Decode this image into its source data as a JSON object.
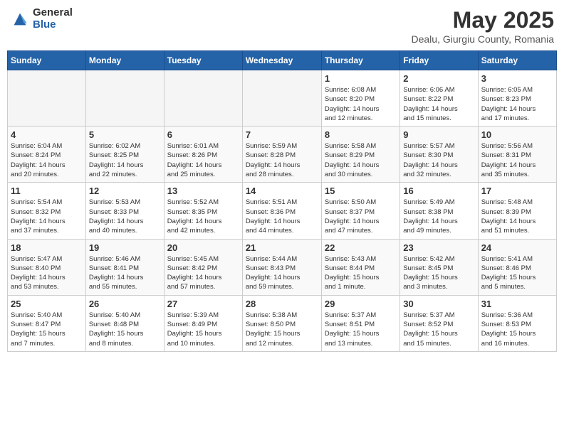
{
  "header": {
    "logo": {
      "general": "General",
      "blue": "Blue"
    },
    "title": "May 2025",
    "subtitle": "Dealu, Giurgiu County, Romania"
  },
  "calendar": {
    "days_of_week": [
      "Sunday",
      "Monday",
      "Tuesday",
      "Wednesday",
      "Thursday",
      "Friday",
      "Saturday"
    ],
    "weeks": [
      {
        "row_class": "row-odd",
        "days": [
          {
            "num": "",
            "info": "",
            "empty": true
          },
          {
            "num": "",
            "info": "",
            "empty": true
          },
          {
            "num": "",
            "info": "",
            "empty": true
          },
          {
            "num": "",
            "info": "",
            "empty": true
          },
          {
            "num": "1",
            "info": "Sunrise: 6:08 AM\nSunset: 8:20 PM\nDaylight: 14 hours\nand 12 minutes.",
            "empty": false
          },
          {
            "num": "2",
            "info": "Sunrise: 6:06 AM\nSunset: 8:22 PM\nDaylight: 14 hours\nand 15 minutes.",
            "empty": false
          },
          {
            "num": "3",
            "info": "Sunrise: 6:05 AM\nSunset: 8:23 PM\nDaylight: 14 hours\nand 17 minutes.",
            "empty": false
          }
        ]
      },
      {
        "row_class": "row-even",
        "days": [
          {
            "num": "4",
            "info": "Sunrise: 6:04 AM\nSunset: 8:24 PM\nDaylight: 14 hours\nand 20 minutes.",
            "empty": false
          },
          {
            "num": "5",
            "info": "Sunrise: 6:02 AM\nSunset: 8:25 PM\nDaylight: 14 hours\nand 22 minutes.",
            "empty": false
          },
          {
            "num": "6",
            "info": "Sunrise: 6:01 AM\nSunset: 8:26 PM\nDaylight: 14 hours\nand 25 minutes.",
            "empty": false
          },
          {
            "num": "7",
            "info": "Sunrise: 5:59 AM\nSunset: 8:28 PM\nDaylight: 14 hours\nand 28 minutes.",
            "empty": false
          },
          {
            "num": "8",
            "info": "Sunrise: 5:58 AM\nSunset: 8:29 PM\nDaylight: 14 hours\nand 30 minutes.",
            "empty": false
          },
          {
            "num": "9",
            "info": "Sunrise: 5:57 AM\nSunset: 8:30 PM\nDaylight: 14 hours\nand 32 minutes.",
            "empty": false
          },
          {
            "num": "10",
            "info": "Sunrise: 5:56 AM\nSunset: 8:31 PM\nDaylight: 14 hours\nand 35 minutes.",
            "empty": false
          }
        ]
      },
      {
        "row_class": "row-odd",
        "days": [
          {
            "num": "11",
            "info": "Sunrise: 5:54 AM\nSunset: 8:32 PM\nDaylight: 14 hours\nand 37 minutes.",
            "empty": false
          },
          {
            "num": "12",
            "info": "Sunrise: 5:53 AM\nSunset: 8:33 PM\nDaylight: 14 hours\nand 40 minutes.",
            "empty": false
          },
          {
            "num": "13",
            "info": "Sunrise: 5:52 AM\nSunset: 8:35 PM\nDaylight: 14 hours\nand 42 minutes.",
            "empty": false
          },
          {
            "num": "14",
            "info": "Sunrise: 5:51 AM\nSunset: 8:36 PM\nDaylight: 14 hours\nand 44 minutes.",
            "empty": false
          },
          {
            "num": "15",
            "info": "Sunrise: 5:50 AM\nSunset: 8:37 PM\nDaylight: 14 hours\nand 47 minutes.",
            "empty": false
          },
          {
            "num": "16",
            "info": "Sunrise: 5:49 AM\nSunset: 8:38 PM\nDaylight: 14 hours\nand 49 minutes.",
            "empty": false
          },
          {
            "num": "17",
            "info": "Sunrise: 5:48 AM\nSunset: 8:39 PM\nDaylight: 14 hours\nand 51 minutes.",
            "empty": false
          }
        ]
      },
      {
        "row_class": "row-even",
        "days": [
          {
            "num": "18",
            "info": "Sunrise: 5:47 AM\nSunset: 8:40 PM\nDaylight: 14 hours\nand 53 minutes.",
            "empty": false
          },
          {
            "num": "19",
            "info": "Sunrise: 5:46 AM\nSunset: 8:41 PM\nDaylight: 14 hours\nand 55 minutes.",
            "empty": false
          },
          {
            "num": "20",
            "info": "Sunrise: 5:45 AM\nSunset: 8:42 PM\nDaylight: 14 hours\nand 57 minutes.",
            "empty": false
          },
          {
            "num": "21",
            "info": "Sunrise: 5:44 AM\nSunset: 8:43 PM\nDaylight: 14 hours\nand 59 minutes.",
            "empty": false
          },
          {
            "num": "22",
            "info": "Sunrise: 5:43 AM\nSunset: 8:44 PM\nDaylight: 15 hours\nand 1 minute.",
            "empty": false
          },
          {
            "num": "23",
            "info": "Sunrise: 5:42 AM\nSunset: 8:45 PM\nDaylight: 15 hours\nand 3 minutes.",
            "empty": false
          },
          {
            "num": "24",
            "info": "Sunrise: 5:41 AM\nSunset: 8:46 PM\nDaylight: 15 hours\nand 5 minutes.",
            "empty": false
          }
        ]
      },
      {
        "row_class": "row-odd",
        "days": [
          {
            "num": "25",
            "info": "Sunrise: 5:40 AM\nSunset: 8:47 PM\nDaylight: 15 hours\nand 7 minutes.",
            "empty": false
          },
          {
            "num": "26",
            "info": "Sunrise: 5:40 AM\nSunset: 8:48 PM\nDaylight: 15 hours\nand 8 minutes.",
            "empty": false
          },
          {
            "num": "27",
            "info": "Sunrise: 5:39 AM\nSunset: 8:49 PM\nDaylight: 15 hours\nand 10 minutes.",
            "empty": false
          },
          {
            "num": "28",
            "info": "Sunrise: 5:38 AM\nSunset: 8:50 PM\nDaylight: 15 hours\nand 12 minutes.",
            "empty": false
          },
          {
            "num": "29",
            "info": "Sunrise: 5:37 AM\nSunset: 8:51 PM\nDaylight: 15 hours\nand 13 minutes.",
            "empty": false
          },
          {
            "num": "30",
            "info": "Sunrise: 5:37 AM\nSunset: 8:52 PM\nDaylight: 15 hours\nand 15 minutes.",
            "empty": false
          },
          {
            "num": "31",
            "info": "Sunrise: 5:36 AM\nSunset: 8:53 PM\nDaylight: 15 hours\nand 16 minutes.",
            "empty": false
          }
        ]
      }
    ]
  }
}
